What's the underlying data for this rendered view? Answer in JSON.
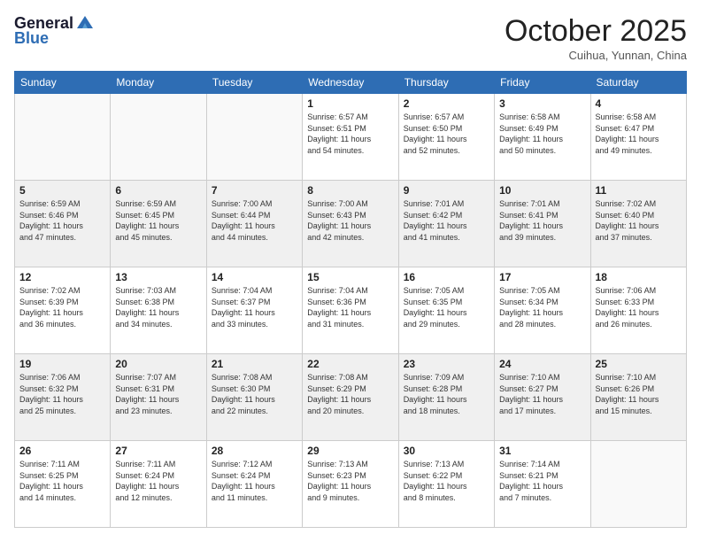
{
  "header": {
    "logo_line1": "General",
    "logo_line2": "Blue",
    "month": "October 2025",
    "location": "Cuihua, Yunnan, China"
  },
  "days_of_week": [
    "Sunday",
    "Monday",
    "Tuesday",
    "Wednesday",
    "Thursday",
    "Friday",
    "Saturday"
  ],
  "weeks": [
    {
      "shaded": false,
      "days": [
        {
          "num": "",
          "info": ""
        },
        {
          "num": "",
          "info": ""
        },
        {
          "num": "",
          "info": ""
        },
        {
          "num": "1",
          "info": "Sunrise: 6:57 AM\nSunset: 6:51 PM\nDaylight: 11 hours\nand 54 minutes."
        },
        {
          "num": "2",
          "info": "Sunrise: 6:57 AM\nSunset: 6:50 PM\nDaylight: 11 hours\nand 52 minutes."
        },
        {
          "num": "3",
          "info": "Sunrise: 6:58 AM\nSunset: 6:49 PM\nDaylight: 11 hours\nand 50 minutes."
        },
        {
          "num": "4",
          "info": "Sunrise: 6:58 AM\nSunset: 6:47 PM\nDaylight: 11 hours\nand 49 minutes."
        }
      ]
    },
    {
      "shaded": true,
      "days": [
        {
          "num": "5",
          "info": "Sunrise: 6:59 AM\nSunset: 6:46 PM\nDaylight: 11 hours\nand 47 minutes."
        },
        {
          "num": "6",
          "info": "Sunrise: 6:59 AM\nSunset: 6:45 PM\nDaylight: 11 hours\nand 45 minutes."
        },
        {
          "num": "7",
          "info": "Sunrise: 7:00 AM\nSunset: 6:44 PM\nDaylight: 11 hours\nand 44 minutes."
        },
        {
          "num": "8",
          "info": "Sunrise: 7:00 AM\nSunset: 6:43 PM\nDaylight: 11 hours\nand 42 minutes."
        },
        {
          "num": "9",
          "info": "Sunrise: 7:01 AM\nSunset: 6:42 PM\nDaylight: 11 hours\nand 41 minutes."
        },
        {
          "num": "10",
          "info": "Sunrise: 7:01 AM\nSunset: 6:41 PM\nDaylight: 11 hours\nand 39 minutes."
        },
        {
          "num": "11",
          "info": "Sunrise: 7:02 AM\nSunset: 6:40 PM\nDaylight: 11 hours\nand 37 minutes."
        }
      ]
    },
    {
      "shaded": false,
      "days": [
        {
          "num": "12",
          "info": "Sunrise: 7:02 AM\nSunset: 6:39 PM\nDaylight: 11 hours\nand 36 minutes."
        },
        {
          "num": "13",
          "info": "Sunrise: 7:03 AM\nSunset: 6:38 PM\nDaylight: 11 hours\nand 34 minutes."
        },
        {
          "num": "14",
          "info": "Sunrise: 7:04 AM\nSunset: 6:37 PM\nDaylight: 11 hours\nand 33 minutes."
        },
        {
          "num": "15",
          "info": "Sunrise: 7:04 AM\nSunset: 6:36 PM\nDaylight: 11 hours\nand 31 minutes."
        },
        {
          "num": "16",
          "info": "Sunrise: 7:05 AM\nSunset: 6:35 PM\nDaylight: 11 hours\nand 29 minutes."
        },
        {
          "num": "17",
          "info": "Sunrise: 7:05 AM\nSunset: 6:34 PM\nDaylight: 11 hours\nand 28 minutes."
        },
        {
          "num": "18",
          "info": "Sunrise: 7:06 AM\nSunset: 6:33 PM\nDaylight: 11 hours\nand 26 minutes."
        }
      ]
    },
    {
      "shaded": true,
      "days": [
        {
          "num": "19",
          "info": "Sunrise: 7:06 AM\nSunset: 6:32 PM\nDaylight: 11 hours\nand 25 minutes."
        },
        {
          "num": "20",
          "info": "Sunrise: 7:07 AM\nSunset: 6:31 PM\nDaylight: 11 hours\nand 23 minutes."
        },
        {
          "num": "21",
          "info": "Sunrise: 7:08 AM\nSunset: 6:30 PM\nDaylight: 11 hours\nand 22 minutes."
        },
        {
          "num": "22",
          "info": "Sunrise: 7:08 AM\nSunset: 6:29 PM\nDaylight: 11 hours\nand 20 minutes."
        },
        {
          "num": "23",
          "info": "Sunrise: 7:09 AM\nSunset: 6:28 PM\nDaylight: 11 hours\nand 18 minutes."
        },
        {
          "num": "24",
          "info": "Sunrise: 7:10 AM\nSunset: 6:27 PM\nDaylight: 11 hours\nand 17 minutes."
        },
        {
          "num": "25",
          "info": "Sunrise: 7:10 AM\nSunset: 6:26 PM\nDaylight: 11 hours\nand 15 minutes."
        }
      ]
    },
    {
      "shaded": false,
      "days": [
        {
          "num": "26",
          "info": "Sunrise: 7:11 AM\nSunset: 6:25 PM\nDaylight: 11 hours\nand 14 minutes."
        },
        {
          "num": "27",
          "info": "Sunrise: 7:11 AM\nSunset: 6:24 PM\nDaylight: 11 hours\nand 12 minutes."
        },
        {
          "num": "28",
          "info": "Sunrise: 7:12 AM\nSunset: 6:24 PM\nDaylight: 11 hours\nand 11 minutes."
        },
        {
          "num": "29",
          "info": "Sunrise: 7:13 AM\nSunset: 6:23 PM\nDaylight: 11 hours\nand 9 minutes."
        },
        {
          "num": "30",
          "info": "Sunrise: 7:13 AM\nSunset: 6:22 PM\nDaylight: 11 hours\nand 8 minutes."
        },
        {
          "num": "31",
          "info": "Sunrise: 7:14 AM\nSunset: 6:21 PM\nDaylight: 11 hours\nand 7 minutes."
        },
        {
          "num": "",
          "info": ""
        }
      ]
    }
  ]
}
